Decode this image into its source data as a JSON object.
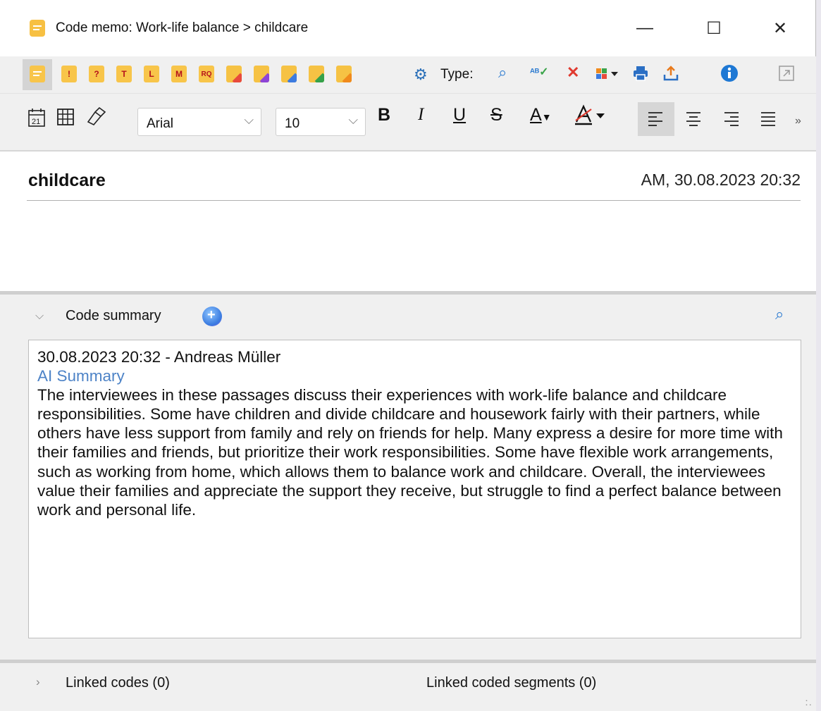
{
  "window": {
    "title": "Code memo: Work-life balance > childcare",
    "controls": {
      "minimize": "—",
      "maximize": "☐",
      "close": "✕"
    }
  },
  "toolbar_top": {
    "memo_types": [
      {
        "name": "memo-default-icon",
        "label": ""
      },
      {
        "name": "memo-exclamation-icon",
        "label": "!"
      },
      {
        "name": "memo-question-icon",
        "label": "?"
      },
      {
        "name": "memo-t-icon",
        "label": "T"
      },
      {
        "name": "memo-l-icon",
        "label": "L"
      },
      {
        "name": "memo-m-icon",
        "label": "M"
      },
      {
        "name": "memo-rq-icon",
        "label": "RQ"
      },
      {
        "name": "memo-red-flag-icon",
        "color": "#e84a3c"
      },
      {
        "name": "memo-purple-flag-icon",
        "color": "#8e44d6"
      },
      {
        "name": "memo-blue-flag-icon",
        "color": "#3c7be0"
      },
      {
        "name": "memo-green-flag-icon",
        "color": "#35a14a"
      },
      {
        "name": "memo-orange-flag-icon",
        "color": "#f08a1c"
      }
    ],
    "type_label": "Type:",
    "icons": [
      "search-icon",
      "spellcheck-icon",
      "delete-icon",
      "color-palette-icon",
      "print-icon",
      "export-icon",
      "info-icon",
      "expand-icon"
    ]
  },
  "format_toolbar": {
    "font_family": "Arial",
    "font_size": "10",
    "bold": "B",
    "italic": "I",
    "underline": "U",
    "strike": "S",
    "font_color": "A",
    "more": "»"
  },
  "memo": {
    "title": "childcare",
    "meta": "AM, 30.08.2023 20:32"
  },
  "code_summary": {
    "label": "Code summary",
    "entry_header": "30.08.2023 20:32 - Andreas Müller",
    "ai_label": "AI Summary",
    "text": "The interviewees in these passages discuss their experiences with work-life balance and childcare responsibilities. Some have children and divide childcare and housework fairly with their partners, while others have less support from family and rely on friends for help. Many express a desire for more time with their families and friends, but prioritize their work responsibilities. Some have flexible work arrangements, such as working from home, which allows them to balance work and childcare. Overall, the interviewees value their families and appreciate the support they receive, but struggle to find a perfect balance between work and personal life."
  },
  "linked": {
    "codes": "Linked codes (0)",
    "segments": "Linked coded segments (0)"
  }
}
